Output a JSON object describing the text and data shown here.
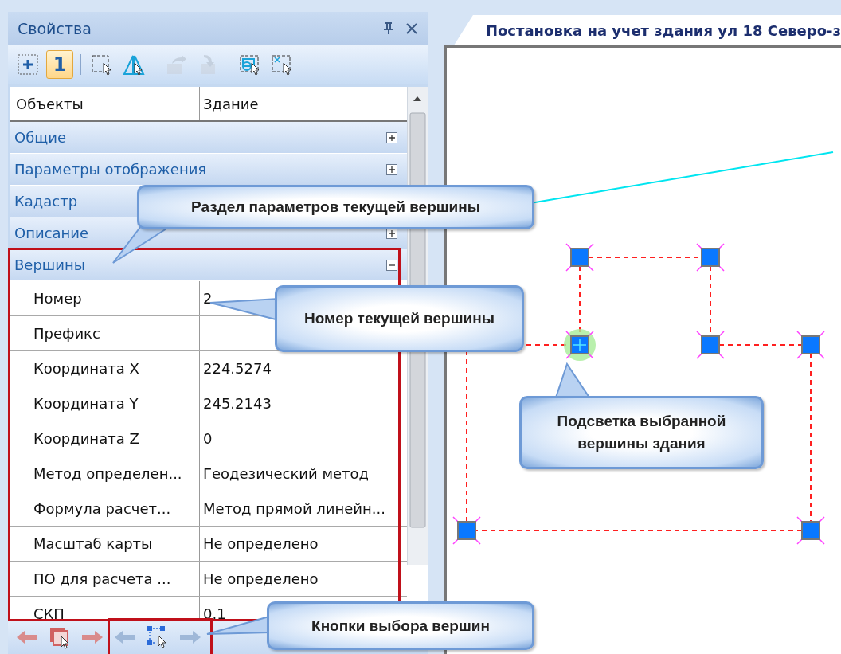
{
  "panel": {
    "title": "Свойства",
    "toolbar": [
      {
        "kind": "add",
        "selected": false,
        "disabled": false
      },
      {
        "kind": "number",
        "label": "1",
        "selected": true,
        "disabled": false
      },
      {
        "kind": "sep"
      },
      {
        "kind": "select",
        "selected": false,
        "disabled": false
      },
      {
        "kind": "mirror",
        "selected": false,
        "disabled": false
      },
      {
        "kind": "sep"
      },
      {
        "kind": "export",
        "selected": false,
        "disabled": true
      },
      {
        "kind": "import",
        "selected": false,
        "disabled": true
      },
      {
        "kind": "sep"
      },
      {
        "kind": "select-shape",
        "selected": false,
        "disabled": false
      },
      {
        "kind": "deselect",
        "selected": false,
        "disabled": false
      }
    ],
    "header_row": {
      "name": "Объекты",
      "value": "Здание"
    },
    "categories": [
      {
        "title": "Общие",
        "expanded": false
      },
      {
        "title": "Параметры отображения",
        "expanded": false
      },
      {
        "title": "Кадастр"
      },
      {
        "title": "Описание",
        "expanded": false
      },
      {
        "title": "Вершины",
        "expanded": true,
        "rows": [
          {
            "name": "Номер",
            "value": "2"
          },
          {
            "name": "Префикс"
          },
          {
            "name": "Координата X",
            "value": "224.5274"
          },
          {
            "name": "Координата Y",
            "value": "245.2143"
          },
          {
            "name": "Координата Z",
            "value": "0"
          },
          {
            "name": "Метод определен...",
            "value": "Геодезический метод"
          },
          {
            "name": "Формула расчет...",
            "value": "Метод прямой линейн..."
          },
          {
            "name": "Масштаб карты",
            "value": "Не определено"
          },
          {
            "name": "ПО для расчета ...",
            "value": "Не определено"
          },
          {
            "name": "СКП",
            "value": "0.1"
          }
        ]
      }
    ],
    "bottom_buttons": [
      {
        "kind": "prev",
        "color": "#d98b8b"
      },
      {
        "kind": "select-object",
        "color": "#d06060"
      },
      {
        "kind": "next",
        "color": "#d98b8b"
      },
      {
        "kind": "prev",
        "color": "#9fb8d8"
      },
      {
        "kind": "select-vertex",
        "color": "#2a6ad8"
      },
      {
        "kind": "next",
        "color": "#9fb8d8"
      }
    ]
  },
  "document": {
    "tab_title": "Постановка на учет здания ул 18 Северо-з",
    "vertices": [
      {
        "selected": false
      },
      {
        "selected": false
      },
      {
        "selected": true
      },
      {
        "selected": false
      },
      {
        "selected": false
      },
      {
        "selected": false
      },
      {
        "selected": false
      }
    ]
  },
  "callouts": [
    {
      "text": "Раздел параметров текущей вершины"
    },
    {
      "text": "Номер текущей вершины"
    },
    {
      "text": "Подсветка выбранной вершины здания"
    },
    {
      "text": "Кнопки выбора вершин"
    }
  ]
}
